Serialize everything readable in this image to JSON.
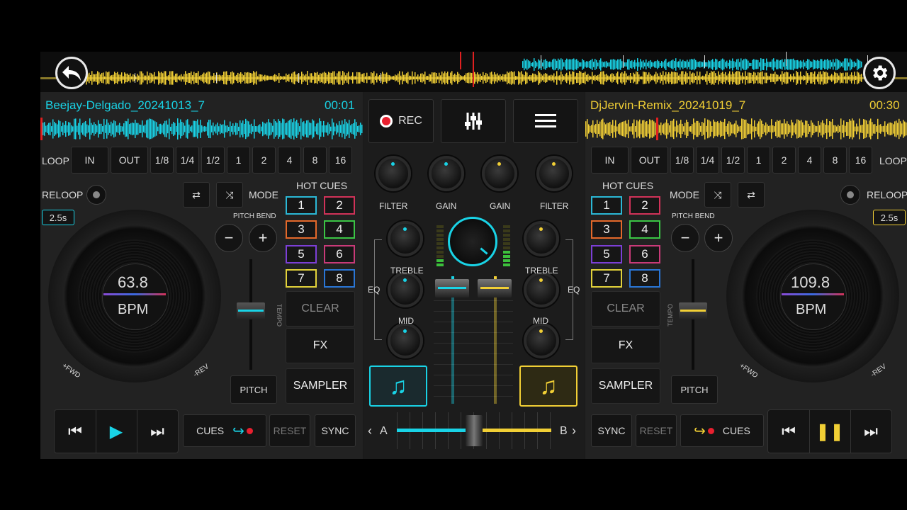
{
  "colors": {
    "deck_a": "#19d3e6",
    "deck_b": "#f1cf35",
    "rec": "#e8202f",
    "hot_cues": [
      "#2bb8d6",
      "#d13259",
      "#e4682a",
      "#3bc545",
      "#7c3fd6",
      "#c93a78",
      "#e2d23a",
      "#2a76d6"
    ]
  },
  "top": {
    "back_icon": "back-arrow-icon",
    "settings_icon": "gear-icon"
  },
  "deck_a": {
    "track": "Beejay-Delgado_20241013_7",
    "time": "00:01",
    "loop_label": "LOOP",
    "loop_buttons": [
      "IN",
      "OUT",
      "1/8",
      "1/4",
      "1/2",
      "1",
      "2",
      "4",
      "8",
      "16"
    ],
    "reloop": "RELOOP",
    "reloop_time": "2.5s",
    "mode": "MODE",
    "hot_cues": "HOT CUES",
    "cue_numbers": [
      "1",
      "2",
      "3",
      "4",
      "5",
      "6",
      "7",
      "8"
    ],
    "pitch_bend": "PITCH BEND",
    "minus": "−",
    "plus": "+",
    "tempo": "TEMPO",
    "clear": "CLEAR",
    "fx": "FX",
    "sampler": "SAMPLER",
    "pitch": "PITCH",
    "bpm_value": "63.8",
    "bpm_label": "BPM",
    "fwd": "+FWD",
    "rev": "-REV",
    "cues": "CUES",
    "reset": "RESET",
    "sync": "SYNC"
  },
  "deck_b": {
    "track": "DjJervin-Remix_20241019_7",
    "time": "00:30",
    "loop_label": "LOOP",
    "loop_buttons": [
      "IN",
      "OUT",
      "1/8",
      "1/4",
      "1/2",
      "1",
      "2",
      "4",
      "8",
      "16"
    ],
    "reloop": "RELOOP",
    "reloop_time": "2.5s",
    "mode": "MODE",
    "hot_cues": "HOT CUES",
    "cue_numbers": [
      "1",
      "2",
      "3",
      "4",
      "5",
      "6",
      "7",
      "8"
    ],
    "pitch_bend": "PITCH BEND",
    "minus": "−",
    "plus": "+",
    "tempo": "TEMPO",
    "clear": "CLEAR",
    "fx": "FX",
    "sampler": "SAMPLER",
    "pitch": "PITCH",
    "bpm_value": "109.8",
    "bpm_label": "BPM",
    "fwd": "+FWD",
    "rev": "-REV",
    "cues": "CUES",
    "reset": "RESET",
    "sync": "SYNC"
  },
  "mixer": {
    "rec": "REC",
    "filter": "FILTER",
    "gain": "GAIN",
    "treble": "TREBLE",
    "mid": "MID",
    "eq": "EQ",
    "crossfader_a": "A",
    "crossfader_b": "B",
    "crossfader_position": 0.5,
    "volume_a": 0.08,
    "volume_b": 0.08
  }
}
